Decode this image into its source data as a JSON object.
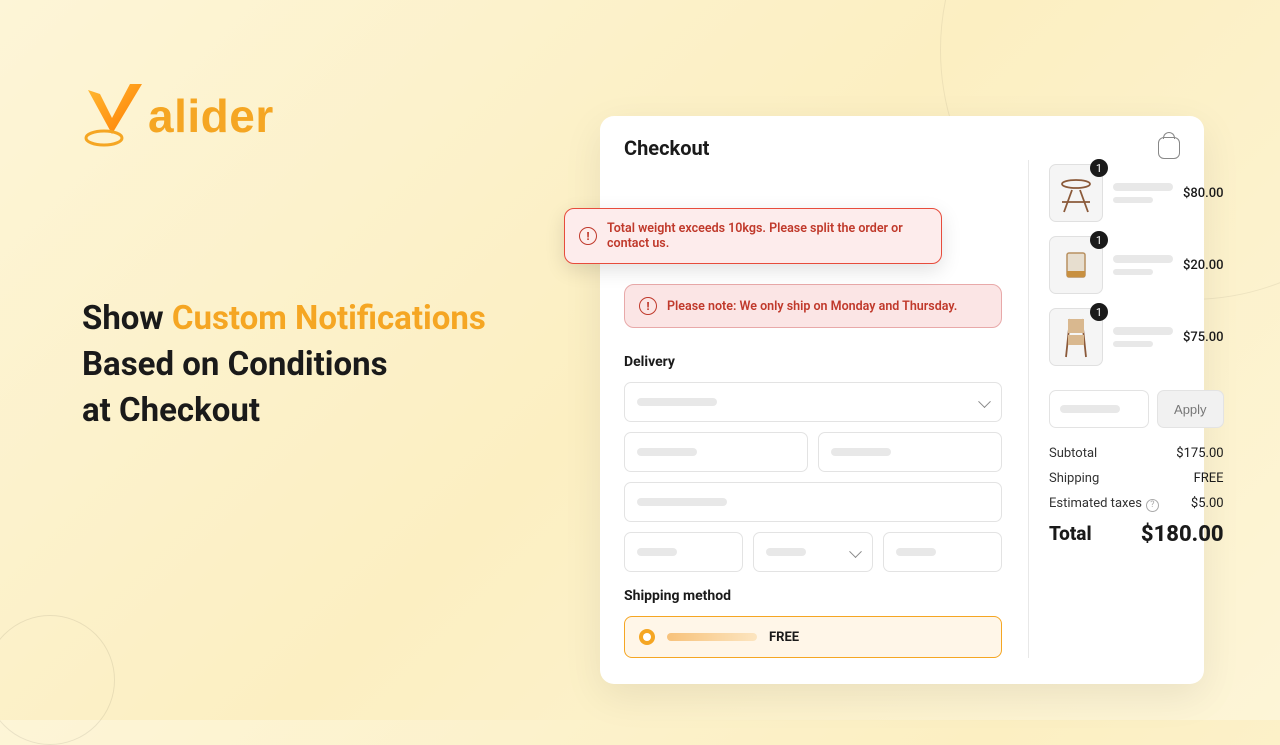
{
  "brand": {
    "name": "alider"
  },
  "tagline": {
    "line1_a": "Show ",
    "line1_b": "Custom Notifications",
    "line2": "Based on Conditions",
    "line3": "at Checkout"
  },
  "checkout": {
    "title": "Checkout",
    "alerts": [
      "Total weight exceeds 10kgs. Please split the order or contact us.",
      "Please note: We only ship on Monday and Thursday."
    ],
    "delivery_label": "Delivery",
    "shipping_method_label": "Shipping method",
    "shipping_price": "FREE",
    "apply_label": "Apply",
    "items": [
      {
        "qty": "1",
        "price": "$80.00"
      },
      {
        "qty": "1",
        "price": "$20.00"
      },
      {
        "qty": "1",
        "price": "$75.00"
      }
    ],
    "summary": {
      "subtotal_label": "Subtotal",
      "subtotal": "$175.00",
      "shipping_label": "Shipping",
      "shipping": "FREE",
      "tax_label": "Estimated taxes",
      "tax": "$5.00",
      "total_label": "Total",
      "total": "$180.00"
    }
  }
}
